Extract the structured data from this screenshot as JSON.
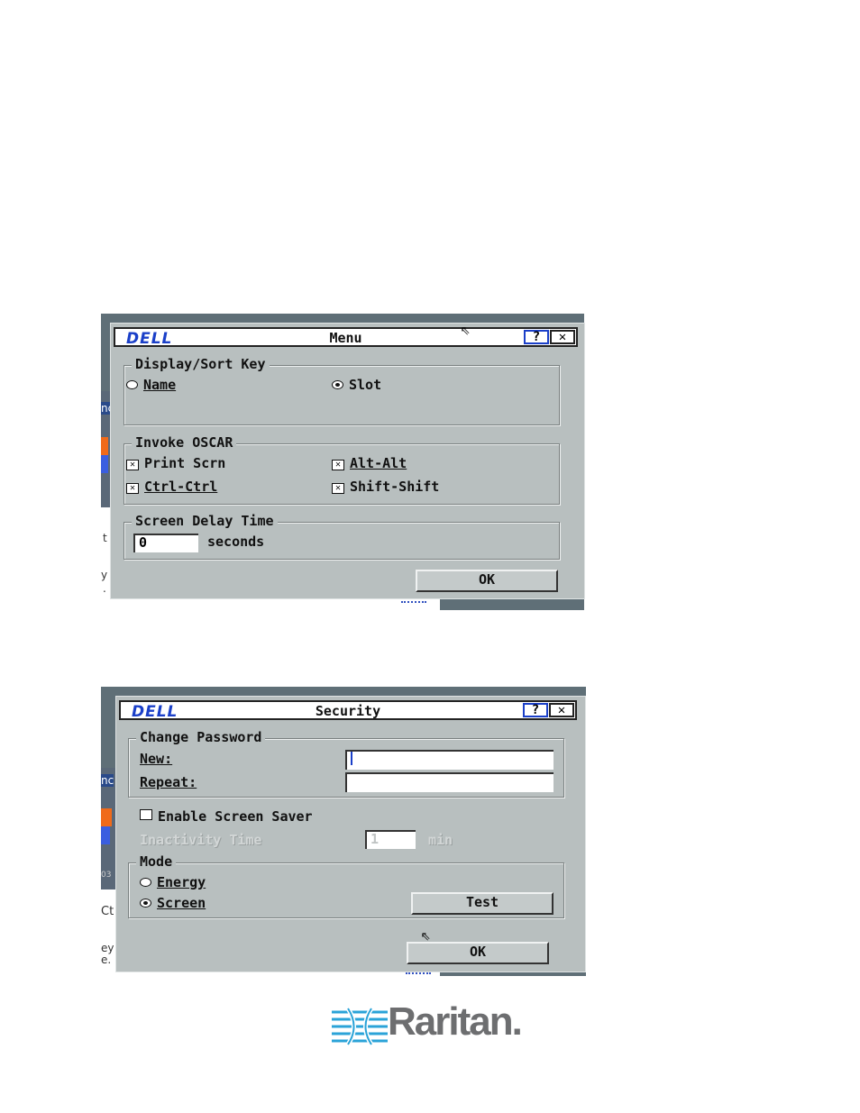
{
  "menu_dialog": {
    "brand": "DELL",
    "title": "Menu",
    "help_label": "?",
    "close_label": "✕",
    "display_sort": {
      "legend": "Display/Sort Key",
      "options": [
        {
          "label": "Name",
          "selected": false
        },
        {
          "label": "Slot",
          "selected": true
        }
      ]
    },
    "invoke_oscar": {
      "legend": "Invoke OSCAR",
      "options": [
        {
          "label": "Print Scrn",
          "checked": true
        },
        {
          "label": "Alt-Alt",
          "checked": true
        },
        {
          "label": "Ctrl-Ctrl",
          "checked": true
        },
        {
          "label": "Shift-Shift",
          "checked": true
        }
      ]
    },
    "screen_delay": {
      "legend": "Screen Delay Time",
      "value": "0",
      "unit": "seconds"
    },
    "ok_label": "OK"
  },
  "security_dialog": {
    "brand": "DELL",
    "title": "Security",
    "help_label": "?",
    "close_label": "✕",
    "change_password": {
      "legend": "Change Password",
      "new_label": "New:",
      "new_value": "",
      "repeat_label": "Repeat:",
      "repeat_value": ""
    },
    "screen_saver": {
      "label": "Enable Screen Saver",
      "checked": false,
      "inactivity_label": "Inactivity Time",
      "inactivity_value": "1",
      "inactivity_unit": "min"
    },
    "mode": {
      "legend": "Mode",
      "options": [
        {
          "label": "Energy",
          "selected": false
        },
        {
          "label": "Screen",
          "selected": true
        }
      ],
      "test_label": "Test"
    },
    "ok_label": "OK"
  },
  "side_text": {
    "menu": [
      "nc",
      "t",
      "y",
      "."
    ],
    "security": [
      "nc",
      "03",
      "Ct",
      "ey",
      "e."
    ]
  },
  "footer": {
    "logo_text": "Raritan."
  }
}
